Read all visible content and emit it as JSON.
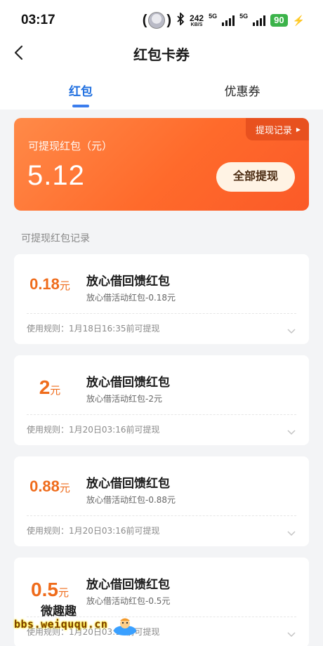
{
  "status_bar": {
    "time": "03:17",
    "net_speed_value": "242",
    "net_speed_unit": "KB/S",
    "network_1": "5G",
    "network_2": "5G",
    "battery": "90"
  },
  "nav": {
    "title": "红包卡券"
  },
  "tabs": [
    {
      "label": "红包",
      "active": true
    },
    {
      "label": "优惠券",
      "active": false
    }
  ],
  "balance_card": {
    "record_link": "提现记录",
    "label": "可提现红包（元）",
    "amount": "5.12",
    "withdraw_all_label": "全部提现"
  },
  "section_title": "可提现红包记录",
  "records": [
    {
      "amount": "0.18",
      "unit": "元",
      "title": "放心借回馈红包",
      "subtitle": "放心借活动红包-0.18元",
      "rule": "使用规则：1月18日16:35前可提现"
    },
    {
      "amount": "2",
      "unit": "元",
      "title": "放心借回馈红包",
      "subtitle": "放心借活动红包-2元",
      "rule": "使用规则：1月20日03:16前可提现"
    },
    {
      "amount": "0.88",
      "unit": "元",
      "title": "放心借回馈红包",
      "subtitle": "放心借活动红包-0.88元",
      "rule": "使用规则：1月20日03:16前可提现"
    },
    {
      "amount": "0.5",
      "unit": "元",
      "title": "放心借回馈红包",
      "subtitle": "放心借活动红包-0.5元",
      "rule": "使用规则：1月20日03:16前可提现"
    }
  ],
  "watermark": {
    "top": "微趣趣",
    "bottom": "bbs.weiququ.cn"
  },
  "colors": {
    "accent_blue": "#3b7ded",
    "card_orange": "#ff6a2b",
    "amount_orange": "#ef6c1c"
  },
  "icons": {
    "back": "back-arrow-icon",
    "record_arrow": "triangle-right-icon",
    "expand": "chevron-down-icon"
  }
}
